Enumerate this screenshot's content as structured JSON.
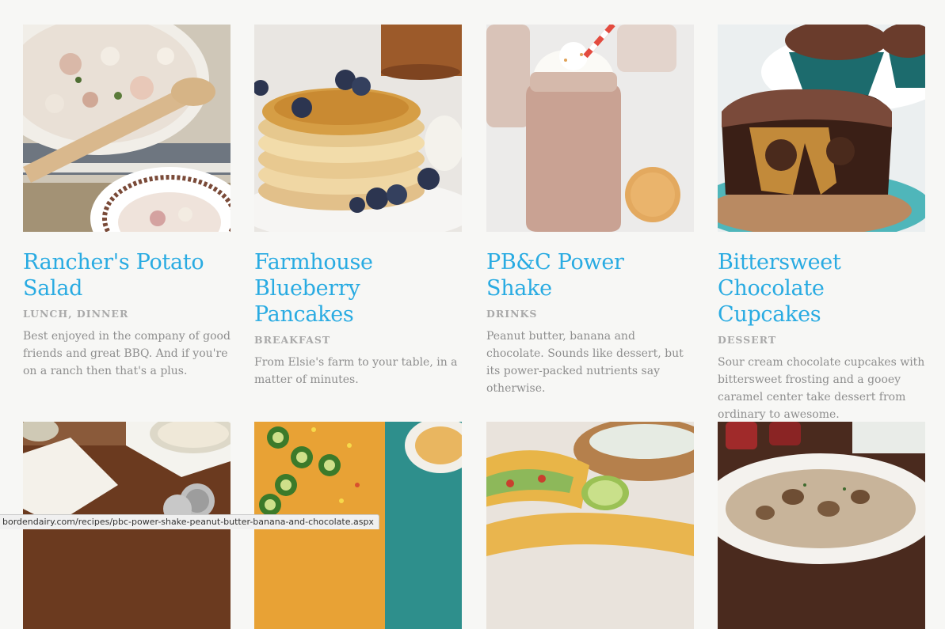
{
  "recipes": [
    {
      "title": "Rancher's Potato Salad",
      "category": "LUNCH, DINNER",
      "description": "Best enjoyed in the company of good friends and great BBQ. And if you're on a ranch then that's a plus.",
      "icon": "potato-salad-photo"
    },
    {
      "title": "Farmhouse Blueberry Pancakes",
      "category": "BREAKFAST",
      "description": "From Elsie's farm to your table, in a matter of minutes.",
      "icon": "pancakes-photo"
    },
    {
      "title": "PB&C Power Shake",
      "category": "DRINKS",
      "description": "Peanut butter, banana and chocolate. Sounds like dessert, but its power-packed nutrients say otherwise.",
      "icon": "shake-photo"
    },
    {
      "title": "Bittersweet Chocolate Cupcakes",
      "category": "DESSERT",
      "description": "Sour cream chocolate cupcakes with bittersweet frosting and a gooey caramel center take dessert from ordinary to awesome.",
      "icon": "cupcakes-photo"
    }
  ],
  "second_row_icons": [
    "dip-photo",
    "corn-casserole-photo",
    "tacos-photo",
    "stroganoff-photo"
  ],
  "status_bar": {
    "url": "bordendairy.com/recipes/pbc-power-shake-peanut-butter-banana-and-chocolate.aspx"
  },
  "colors": {
    "title": "#29abe2",
    "category": "#a9a9a9",
    "text": "#8e8e8e",
    "background": "#f7f7f5"
  }
}
